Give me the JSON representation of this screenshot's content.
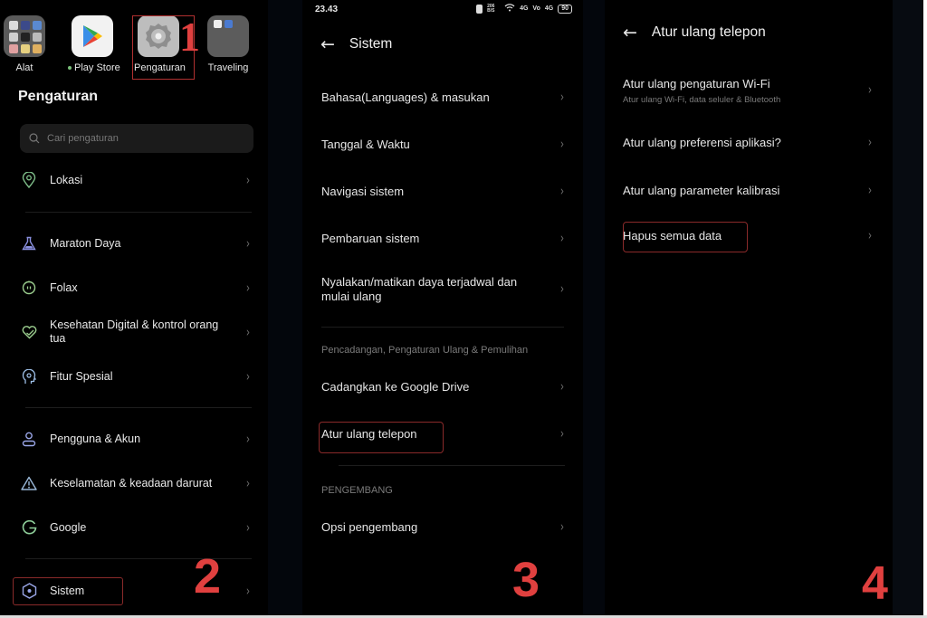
{
  "panel1": {
    "apps": [
      {
        "label": "Alat",
        "icon": "folder-icon"
      },
      {
        "label": "Play Store",
        "icon": "play-store-icon",
        "indicator": "new-dot"
      },
      {
        "label": "Pengaturan",
        "icon": "gear-icon",
        "highlighted": true
      },
      {
        "label": "Traveling",
        "icon": "folder-icon"
      }
    ],
    "step_label": "1",
    "title": "Pengaturan",
    "search_placeholder": "Cari pengaturan",
    "items": [
      {
        "label": "Lokasi",
        "icon": "location-pin-icon",
        "color": "#7fbf8a"
      },
      {
        "label": "Maraton Daya",
        "icon": "flask-icon",
        "color": "#8a90e0"
      },
      {
        "label": "Folax",
        "icon": "folax-icon",
        "color": "#9ccf8f"
      },
      {
        "label": "Kesehatan Digital & kontrol orang tua",
        "icon": "heart-check-icon",
        "color": "#9ccf8f"
      },
      {
        "label": "Fitur Spesial",
        "icon": "head-icon",
        "color": "#9ec0e8"
      },
      {
        "label": "Pengguna & Akun",
        "icon": "user-icon",
        "color": "#9aa6e8"
      },
      {
        "label": "Keselamatan & keadaan darurat",
        "icon": "warning-triangle-icon",
        "color": "#9ab8d8"
      },
      {
        "label": "Google",
        "icon": "google-icon",
        "color": "#8fcf9a"
      },
      {
        "label": "Sistem",
        "icon": "hexagon-icon",
        "color": "#9aa6e8",
        "highlighted": true
      }
    ],
    "step2_label": "2"
  },
  "panel2": {
    "status": {
      "time": "23.43",
      "icons": [
        "vibrate",
        "data-speed",
        "wifi",
        "4G",
        "VoLTE",
        "4G"
      ],
      "battery": "90",
      "speed": "206 B/S"
    },
    "title": "Sistem",
    "items": [
      {
        "label": "Bahasa(Languages) & masukan"
      },
      {
        "label": "Tanggal & Waktu"
      },
      {
        "label": "Navigasi sistem"
      },
      {
        "label": "Pembaruan sistem"
      },
      {
        "label": "Nyalakan/matikan daya terjadwal dan mulai ulang"
      }
    ],
    "section_backup": "Pencadangan, Pengaturan Ulang & Pemulihan",
    "backup_items": [
      {
        "label": "Cadangkan ke Google Drive"
      },
      {
        "label": "Atur ulang telepon",
        "highlighted": true
      }
    ],
    "section_dev": "PENGEMBANG",
    "dev_items": [
      {
        "label": "Opsi pengembang"
      }
    ],
    "step_label": "3"
  },
  "panel3": {
    "title": "Atur ulang telepon",
    "items": [
      {
        "label": "Atur ulang pengaturan Wi-Fi",
        "sub": "Atur ulang Wi-Fi, data seluler & Bluetooth"
      },
      {
        "label": "Atur ulang preferensi aplikasi?"
      },
      {
        "label": "Atur ulang parameter kalibrasi"
      },
      {
        "label": "Hapus semua data",
        "highlighted": true
      }
    ],
    "step_label": "4"
  },
  "colors": {
    "highlight_border": "#8a2a2a",
    "step_number": "#e0403f",
    "background": "#000000"
  }
}
